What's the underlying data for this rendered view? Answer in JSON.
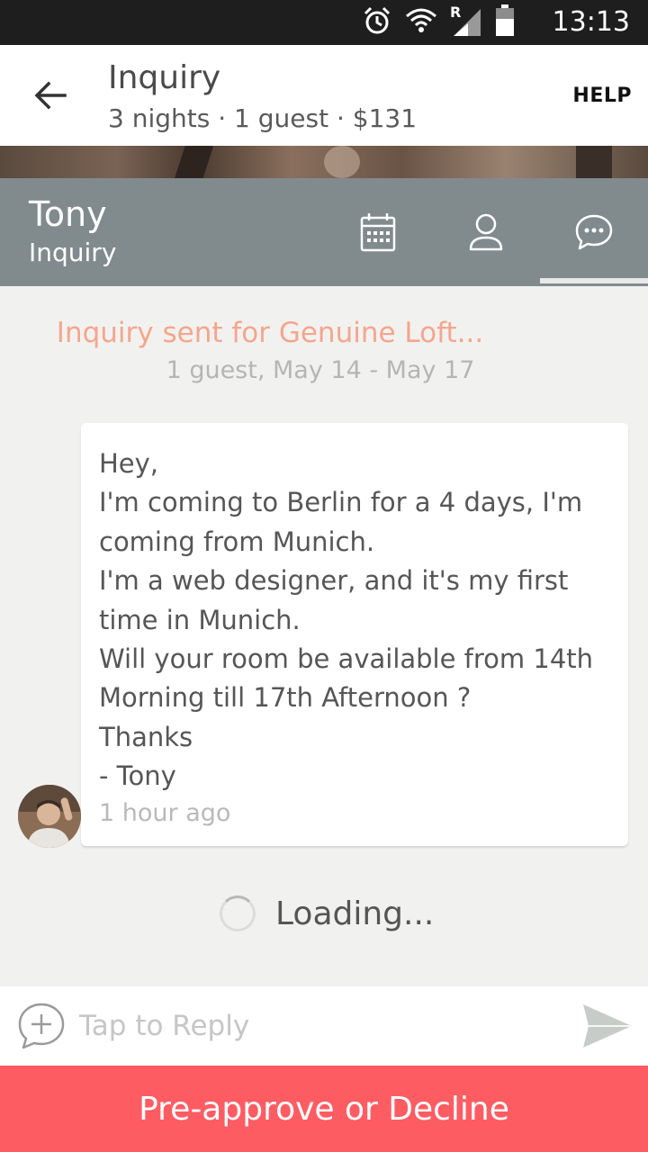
{
  "status_bar": {
    "time": "13:13",
    "network_letter": "R",
    "icons": [
      "alarm-icon",
      "wifi-icon",
      "signal-icon",
      "battery-icon"
    ]
  },
  "app_bar": {
    "back_icon": "arrow-left-icon",
    "title": "Inquiry",
    "subtitle": "3 nights · 1 guest · $131",
    "help_label": "HELP"
  },
  "guest_header": {
    "name": "Tony",
    "status": "Inquiry",
    "tabs": [
      {
        "icon": "calendar-icon",
        "active": false
      },
      {
        "icon": "profile-icon",
        "active": false
      },
      {
        "icon": "chat-icon",
        "active": true
      }
    ]
  },
  "inquiry": {
    "title": "Inquiry sent for Genuine Loft...",
    "details": "1 guest, May 14 - May 17"
  },
  "message": {
    "text": "Hey,\nI'm coming to Berlin for a 4 days, I'm coming from Munich.\nI'm a web designer, and it's my first time in Munich.\nWill your room be available from 14th Morning till 17th Afternoon ?\nThanks\n- Tony",
    "timestamp": "1 hour ago"
  },
  "loading": {
    "text": "Loading..."
  },
  "reply": {
    "placeholder": "Tap to Reply",
    "add_icon": "add-circle-icon",
    "send_icon": "send-icon"
  },
  "action": {
    "label": "Pre-approve or Decline"
  },
  "colors": {
    "accent": "#fd5c63",
    "header_gray": "#818b8e",
    "inquiry_orange": "#f6a58d",
    "background": "#f1f2f0"
  }
}
